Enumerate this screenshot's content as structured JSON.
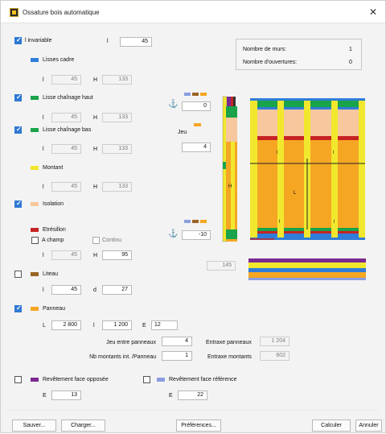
{
  "window": {
    "title": "Ossature bois automatique"
  },
  "linvariable": {
    "label": "l invariable",
    "l_label": "l",
    "l_value": "45"
  },
  "lisses_cadre": {
    "label": "Lisses cadre",
    "l_label": "l",
    "l_value": "45",
    "h_label": "H",
    "h_value": "133",
    "color": "#2f7dd8"
  },
  "lisse_chainage_haut": {
    "label": "Lisse chaînage haut",
    "l_label": "l",
    "l_value": "45",
    "h_label": "H",
    "h_value": "133",
    "color": "#19a34a"
  },
  "lisse_chainage_bas": {
    "label": "Lisse chaînage bas",
    "l_label": "l",
    "l_value": "45",
    "h_label": "H",
    "h_value": "133",
    "color": "#19a34a"
  },
  "montant": {
    "label": "Montant",
    "l_label": "l",
    "l_value": "45",
    "h_label": "H",
    "h_value": "133",
    "color": "#f1e82e"
  },
  "isolation": {
    "label": "Isolation",
    "color": "#f7c79d"
  },
  "etresillon": {
    "label": "Etrésillon",
    "a_champ": "A champ",
    "continu": "Continu",
    "l_label": "l",
    "l_value": "45",
    "h_label": "H",
    "h_value": "95",
    "color": "#c62323"
  },
  "liteau": {
    "label": "Liteau",
    "l_label": "l",
    "l_value": "45",
    "d_label": "d",
    "d_value": "27",
    "color": "#9b6425"
  },
  "panneau": {
    "label": "Panneau",
    "L_label": "L",
    "L_value": "2 800",
    "l_label": "l",
    "l_value": "1 200",
    "E_label": "E",
    "E_value": "12",
    "color": "#f5a623",
    "jeu_label": "Jeu entre panneaux",
    "jeu_value": "4",
    "nb_label": "Nb montants int. /Panneau",
    "nb_value": "1",
    "entraxe_p_label": "Entraxe panneaux",
    "entraxe_p_value": "1 204",
    "entraxe_m_label": "Entraxe montants",
    "entraxe_m_value": "602"
  },
  "rev_oppose": {
    "label": "Revêtement face opposée",
    "E_label": "E",
    "E_value": "13",
    "color": "#7b2a92"
  },
  "rev_reference": {
    "label": "Revêtement face référence",
    "E_label": "E",
    "E_value": "22",
    "color": "#8a9ee0"
  },
  "info": {
    "murs_label": "Nombre de murs:",
    "murs_value": "1",
    "ouv_label": "Nombre d'ouvertures:",
    "ouv_value": "0"
  },
  "diagram": {
    "top_value": "0",
    "jeu_label": "Jeu",
    "jeu_value": "4",
    "bottom_value": "-10",
    "bottom_right_value": "145",
    "l1": "l",
    "l2": "l",
    "L": "L",
    "l3": "l",
    "l4": "l",
    "H": "H"
  },
  "buttons": {
    "sauver": "Sauver...",
    "charger": "Charger...",
    "preferences": "Préférences...",
    "calculer": "Calculer",
    "annuler": "Annuler"
  }
}
